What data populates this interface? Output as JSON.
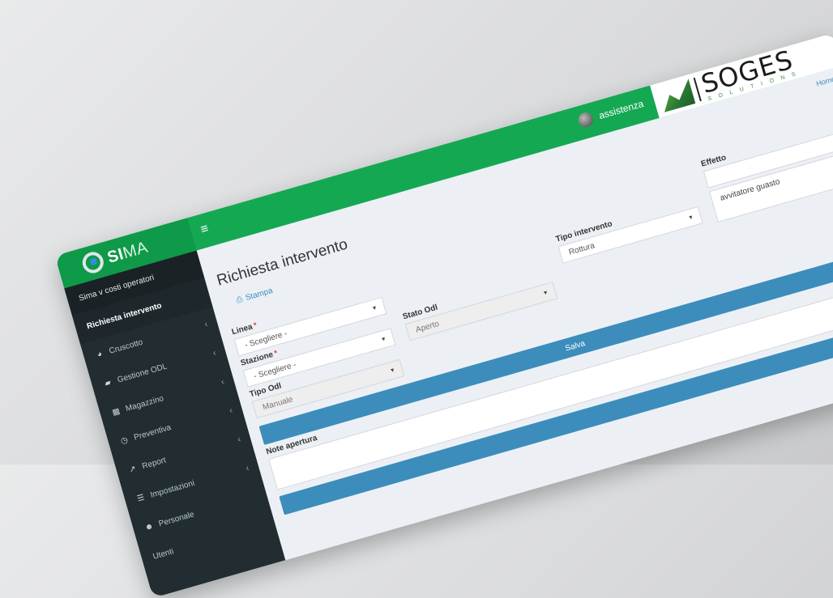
{
  "app": {
    "logo_text_bold": "SI",
    "logo_text_thin": "MA",
    "menu_toggle": "≡"
  },
  "topbar": {
    "username": "assistenza",
    "brand_name": "SOGES",
    "brand_sub": "SOLUTIONS"
  },
  "sidebar": {
    "header": "Sima v costi operatori",
    "items": [
      {
        "label": "Richiesta intervento",
        "icon": "",
        "active": true,
        "has_chevron": false
      },
      {
        "label": "Cruscotto",
        "icon": "dashboard-icon",
        "has_chevron": true
      },
      {
        "label": "Gestione ODL",
        "icon": "folder-icon",
        "has_chevron": true
      },
      {
        "label": "Magazzino",
        "icon": "warehouse-icon",
        "has_chevron": true
      },
      {
        "label": "Preventiva",
        "icon": "clock-icon",
        "has_chevron": true
      },
      {
        "label": "Report",
        "icon": "chart-icon",
        "has_chevron": true
      },
      {
        "label": "Impostazioni",
        "icon": "settings-icon",
        "has_chevron": true
      },
      {
        "label": "Personale",
        "icon": "users-icon",
        "has_chevron": false
      },
      {
        "label": "Utenti",
        "icon": "",
        "has_chevron": false
      }
    ]
  },
  "breadcrumb": {
    "home": "Home"
  },
  "page": {
    "title": "Richiesta intervento",
    "print_link": "Stampa"
  },
  "form": {
    "linea": {
      "label": "Linea",
      "required": true,
      "value": "- Scegliere -"
    },
    "stazione": {
      "label": "Stazione",
      "required": true,
      "value": "- Scegliere -"
    },
    "tipo_odl": {
      "label": "Tipo Odl",
      "value": "Manuale"
    },
    "stato_odl": {
      "label": "Stato Odl",
      "value": "Aperto"
    },
    "tipo_intervento": {
      "label": "Tipo intervento",
      "value": "Rottura"
    },
    "effetto": {
      "label": "Effetto",
      "value": "avvitatore guasto"
    },
    "note_apertura": {
      "label": "Note apertura",
      "value": ""
    },
    "save_button": "Salva"
  }
}
